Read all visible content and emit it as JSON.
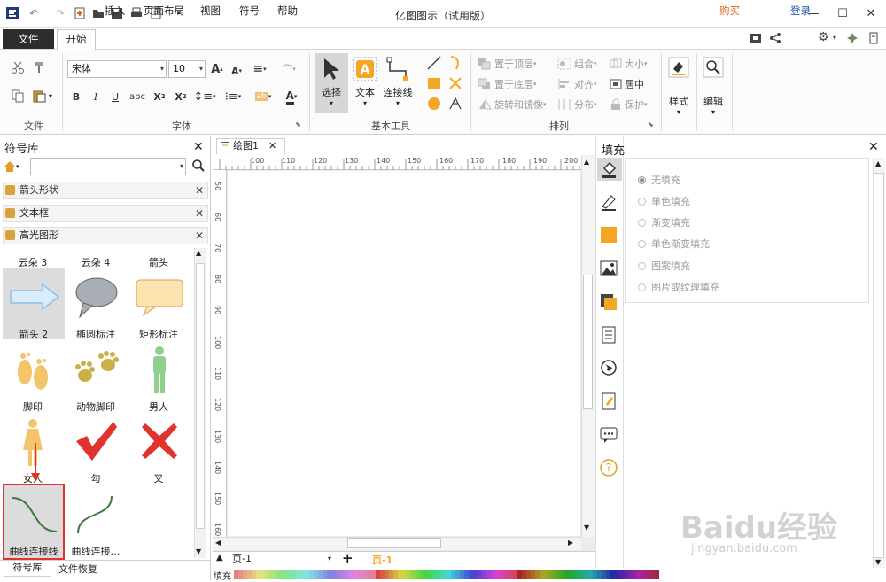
{
  "app": {
    "title": "亿图图示（试用版）"
  },
  "menu": {
    "file": "文件",
    "tabs": [
      "开始",
      "插入",
      "页面布局",
      "视图",
      "符号",
      "帮助"
    ]
  },
  "account": {
    "buy": "购买",
    "login": "登录"
  },
  "ribbon": {
    "groups": {
      "file": "文件",
      "font": "字体",
      "basic_tools": "基本工具",
      "arrange": "排列"
    },
    "font_name": "宋体",
    "font_size": "10",
    "tools": {
      "select": "选择",
      "text": "文本",
      "connector": "连接线",
      "style": "样式",
      "edit": "编辑"
    },
    "arrange": {
      "bring_front": "置于顶层",
      "send_back": "置于底层",
      "rotate_mirror": "旋转和镜像",
      "group": "组合",
      "align": "对齐",
      "distribute": "分布",
      "size": "大小",
      "center": "居中",
      "protect": "保护"
    }
  },
  "left_panel": {
    "title": "符号库",
    "libraries": [
      "箭头形状",
      "文本框",
      "高光图形"
    ],
    "symbols": [
      {
        "label": "云朵 3"
      },
      {
        "label": "云朵 4"
      },
      {
        "label": "箭头"
      },
      {
        "label": "箭头 2"
      },
      {
        "label": "椭圆标注"
      },
      {
        "label": "矩形标注"
      },
      {
        "label": "脚印"
      },
      {
        "label": "动物脚印"
      },
      {
        "label": "男人"
      },
      {
        "label": "女人"
      },
      {
        "label": "勾"
      },
      {
        "label": "叉"
      },
      {
        "label": "曲线连接线"
      },
      {
        "label": "曲线连接…"
      }
    ],
    "bottom_tabs": [
      "符号库",
      "文件恢复"
    ]
  },
  "document": {
    "tab": "绘图1",
    "ruler_top": [
      "100",
      "110",
      "120",
      "130",
      "140",
      "150",
      "160",
      "170",
      "180",
      "190",
      "200"
    ],
    "ruler_left": [
      "50",
      "60",
      "70",
      "80",
      "90",
      "100",
      "110",
      "120",
      "130",
      "140",
      "150",
      "160"
    ],
    "page_select": "页-1",
    "page_tab": "页-1",
    "fill_label": "填充"
  },
  "fill_panel": {
    "title": "填充",
    "options": [
      "无填充",
      "单色填充",
      "渐变填充",
      "单色渐变填充",
      "图案填充",
      "图片或纹理填充"
    ],
    "selected": 0
  },
  "watermark": {
    "brand": "Baidu经验",
    "url": "jingyan.baidu.com"
  },
  "colors": {
    "accent": "#f5a623",
    "highlight": "#e0322e",
    "selected_tool_bg": "#d6d6d6"
  }
}
